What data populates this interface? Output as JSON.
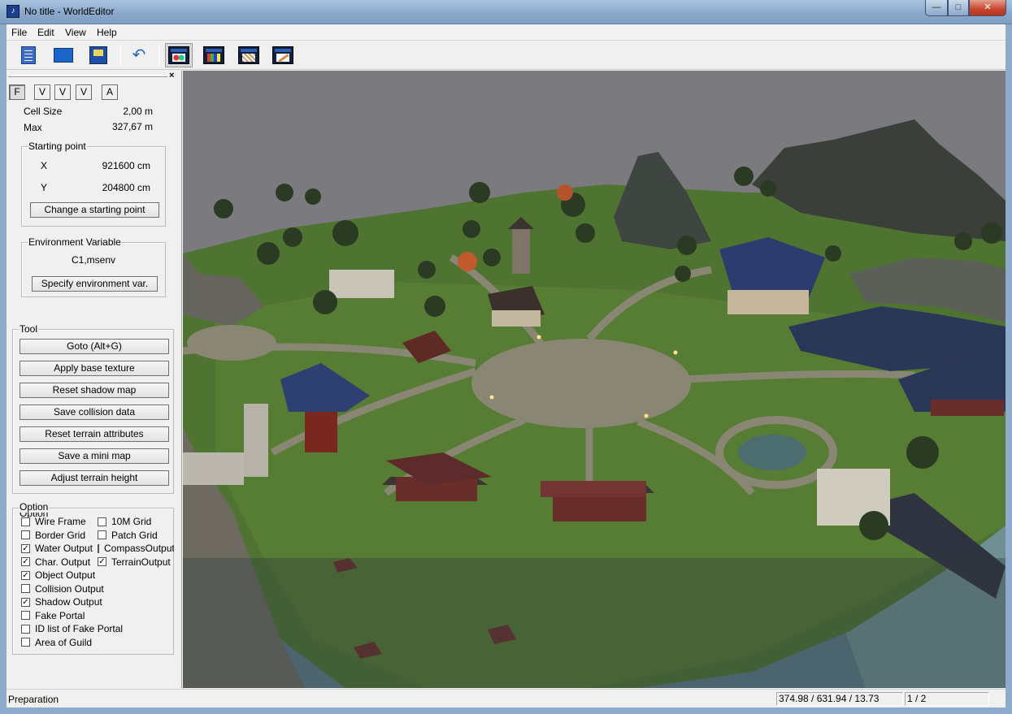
{
  "window": {
    "title": "No title - WorldEditor",
    "min_glyph": "—",
    "max_glyph": "□",
    "close_glyph": "✕"
  },
  "menu": [
    "File",
    "Edit",
    "View",
    "Help"
  ],
  "toolbar": {
    "icons": [
      "new-document-icon",
      "open-folder-icon",
      "save-icon",
      "undo-icon",
      "terrain-window-icon",
      "texture-window-icon",
      "object-window-icon",
      "brush-window-icon"
    ],
    "undo_glyph": "↶"
  },
  "panel": {
    "close_glyph": "×",
    "tabs": [
      "F",
      "V",
      "V",
      "V",
      "A"
    ],
    "cell_size": {
      "label": "Cell Size",
      "value": "2,00 m"
    },
    "max": {
      "label": "Max",
      "value": "327,67 m"
    },
    "starting_point": {
      "label": "Starting point",
      "x": {
        "label": "X",
        "value": "921600 cm"
      },
      "y": {
        "label": "Y",
        "value": "204800 cm"
      },
      "button": "Change a starting point"
    },
    "environment": {
      "label": "Environment Variable",
      "value": "C1,msenv",
      "button": "Specify environment var."
    },
    "tool": {
      "label": "Tool",
      "buttons": [
        "Goto (Alt+G)",
        "Apply base texture",
        "Reset shadow map",
        "Save collision data",
        "Reset terrain attributes",
        "Save a mini map",
        "Adjust terrain height"
      ]
    },
    "option": {
      "label": "Option",
      "check_glyph": "✓",
      "left": [
        {
          "label": "Wire Frame",
          "checked": false
        },
        {
          "label": "Border Grid",
          "checked": false
        },
        {
          "label": "Water Output",
          "checked": true
        },
        {
          "label": "Char. Output",
          "checked": true
        },
        {
          "label": "Object Output",
          "checked": true
        },
        {
          "label": "Collision Output",
          "checked": false
        },
        {
          "label": "Shadow Output",
          "checked": true
        },
        {
          "label": "Fake Portal",
          "checked": false
        },
        {
          "label": "ID list of Fake Portal",
          "checked": false
        },
        {
          "label": "Area of Guild",
          "checked": false
        }
      ],
      "right": [
        {
          "label": "10M Grid",
          "checked": false
        },
        {
          "label": "Patch Grid",
          "checked": false
        },
        {
          "label": "CompassOutput",
          "checked": false
        },
        {
          "label": "TerrainOutput",
          "checked": true
        }
      ]
    }
  },
  "status": {
    "text": "Preparation",
    "coords": "374.98 / 631.94 / 13.73",
    "page": "1 / 2"
  }
}
